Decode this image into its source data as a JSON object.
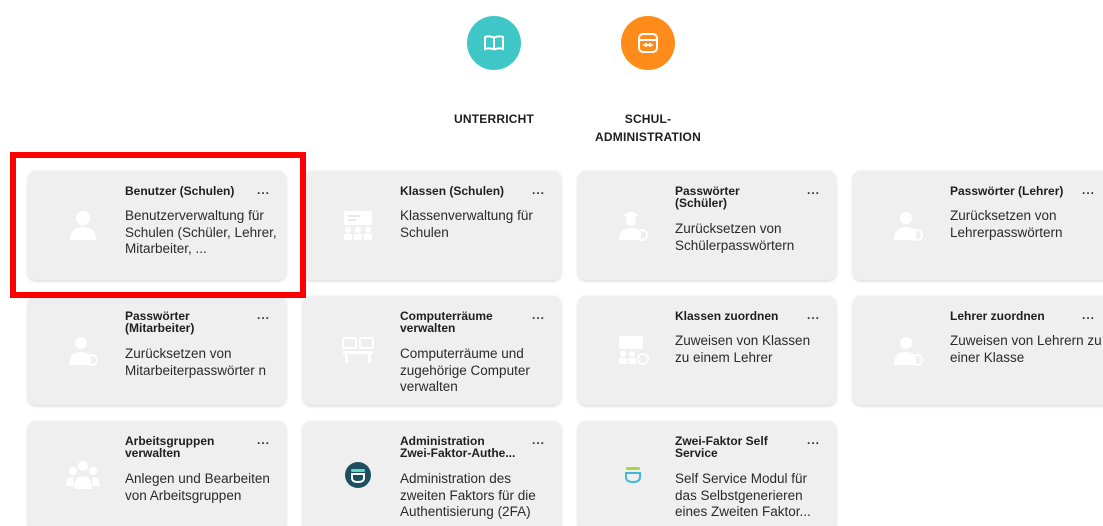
{
  "categories": [
    {
      "label": "UNTERRICHT",
      "color": "#3fc6c6",
      "icon": "book-icon"
    },
    {
      "label": "SCHUL-\nADMINISTRATION",
      "color": "#ff8c1a",
      "icon": "admin-panel-icon"
    }
  ],
  "tiles": [
    {
      "title": "Benutzer (Schulen)",
      "desc": "Benutzerverwaltung für Schulen (Schüler, Lehrer, Mitarbeiter, ...",
      "icon": "user-icon"
    },
    {
      "title": "Klassen (Schulen)",
      "desc": "Klassenverwaltung für Schulen",
      "icon": "classroom-icon"
    },
    {
      "title": "Passwörter\n(Schüler)",
      "desc": "Zurücksetzen von Schülerpasswörtern",
      "icon": "student-password-icon"
    },
    {
      "title": "Passwörter (Lehrer)",
      "desc": "Zurücksetzen von Lehrerpasswörtern",
      "icon": "teacher-password-icon"
    },
    {
      "title": "Passwörter\n(Mitarbeiter)",
      "desc": "Zurücksetzen von Mitarbeiterpasswörter n",
      "icon": "staff-password-icon"
    },
    {
      "title": "Computerräume\nverwalten",
      "desc": "Computerräume und zugehörige Computer verwalten",
      "icon": "computer-room-icon"
    },
    {
      "title": "Klassen zuordnen",
      "desc": "Zuweisen von Klassen zu einem Lehrer",
      "icon": "assign-class-icon"
    },
    {
      "title": "Lehrer zuordnen",
      "desc": "Zuweisen von Lehrern zu einer Klasse",
      "icon": "assign-teacher-icon"
    },
    {
      "title": "Arbeitsgruppen\nverwalten",
      "desc": "Anlegen und Bearbeiten von Arbeitsgruppen",
      "icon": "workgroup-icon"
    },
    {
      "title": "Administration\nZwei-Faktor-Authe...",
      "desc": "Administration des zweiten Faktors für die Authentisierung (2FA)",
      "icon": "two-factor-admin-icon"
    },
    {
      "title": "Zwei-Faktor Self\nService",
      "desc": "Self Service Modul für das Selbstgenerieren eines Zweiten Faktor...",
      "icon": "two-factor-self-service-icon"
    }
  ],
  "menu_label": "..."
}
